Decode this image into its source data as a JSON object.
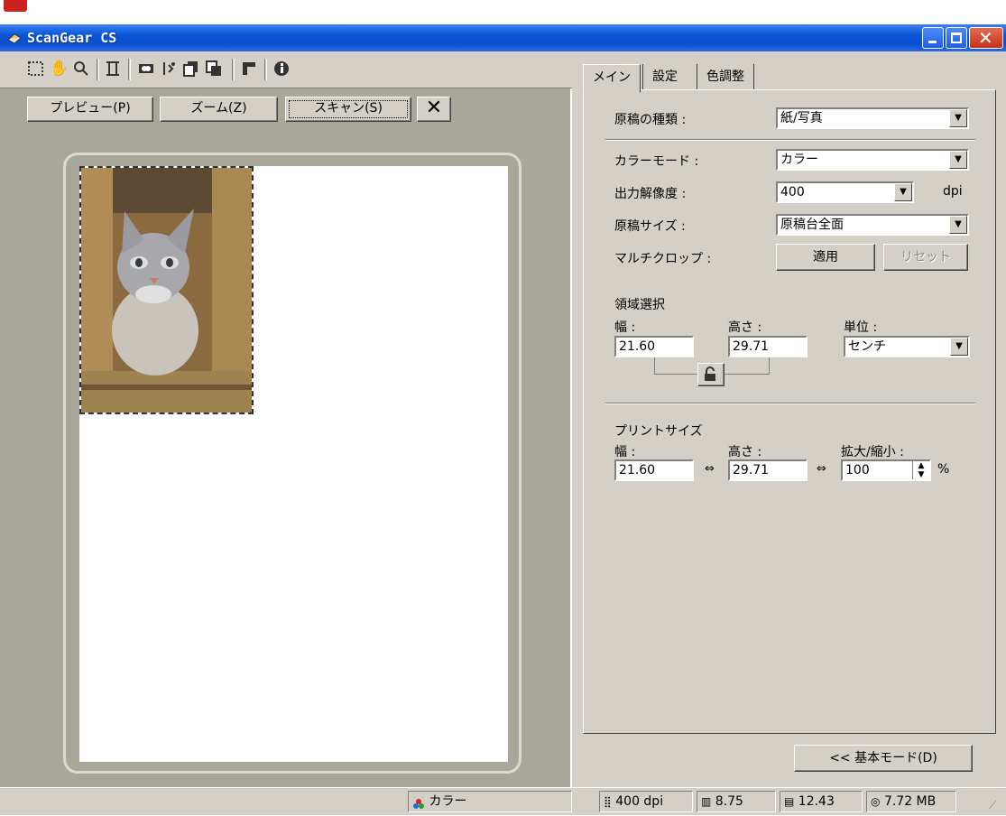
{
  "window": {
    "title": "ScanGear CS"
  },
  "toolbar": {
    "icons": [
      "select-frame-icon",
      "hand-icon",
      "zoom-icon",
      "auto-crop-icon",
      "rotate-icon",
      "flip-icon",
      "copy-icon",
      "paste-icon",
      "frame-icon",
      "info-icon"
    ]
  },
  "actions": {
    "preview": "プレビュー(P)",
    "zoom": "ズーム(Z)",
    "scan": "スキャン(S)",
    "cancel": "✕"
  },
  "tabs": [
    "メイン",
    "設定",
    "色調整"
  ],
  "main": {
    "source_type_label": "原稿の種類 :",
    "source_type_value": "紙/写真",
    "color_mode_label": "カラーモード :",
    "color_mode_value": "カラー",
    "resolution_label": "出力解像度 :",
    "resolution_value": "400",
    "resolution_unit": "dpi",
    "document_size_label": "原稿サイズ :",
    "document_size_value": "原稿台全面",
    "multicrop_label": "マルチクロップ :",
    "apply_button": "適用",
    "reset_button": "リセット",
    "area_title": "領域選択",
    "width_label": "幅 :",
    "height_label": "高さ :",
    "unit_label": "単位 :",
    "width_value": "21.60",
    "height_value": "29.71",
    "unit_value": "センチ",
    "print_title": "プリントサイズ",
    "print_width_label": "幅 :",
    "print_height_label": "高さ :",
    "scale_label": "拡大/縮小 :",
    "print_width_value": "21.60",
    "print_height_value": "29.71",
    "scale_value": "100",
    "percent": "%",
    "basic_mode_button": "<< 基本モード(D)"
  },
  "status": {
    "color": "カラー",
    "dpi": "400 dpi",
    "width": "8.75",
    "height": "12.43",
    "size": "7.72 MB"
  },
  "colors": {
    "titlebar": "#0b4fd0",
    "face": "#d4d0c8",
    "preview_bg": "#a9a69a"
  }
}
